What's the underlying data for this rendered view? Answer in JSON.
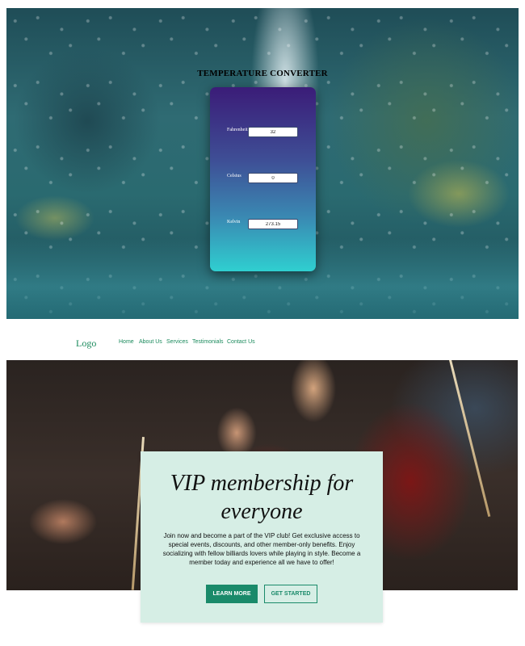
{
  "converter": {
    "title": "TEMPERATURE CONVERTER",
    "fields": [
      {
        "label": "Fahrenheit",
        "value": "32"
      },
      {
        "label": "Celsius",
        "value": "0"
      },
      {
        "label": "Kelvin",
        "value": "273.15"
      }
    ]
  },
  "nav": {
    "logo": "Logo",
    "links": [
      "Home",
      "About Us",
      "Services",
      "Testimonials",
      "Contact Us"
    ]
  },
  "hero": {
    "heading": "VIP membership for everyone",
    "body": "Join now and become a part of the VIP club! Get exclusive access to special events, discounts, and other member-only benefits. Enjoy socializing with fellow billiards lovers while playing in style. Become a member today and experience all we have to offer!",
    "learn_more_label": "LEARN MORE",
    "get_started_label": "GET STARTED"
  },
  "colors": {
    "accent": "#1a8a6a",
    "card_background": "#d6eee5",
    "converter_gradient_top": "#3b1c78",
    "converter_gradient_bottom": "#2fcfd0"
  }
}
